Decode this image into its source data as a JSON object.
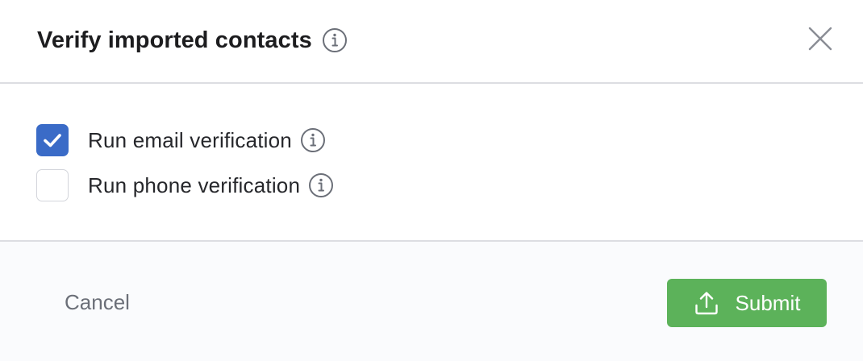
{
  "dialog": {
    "title": "Verify imported contacts",
    "close_icon": "close-icon",
    "title_info_icon": "info-icon"
  },
  "options": [
    {
      "label": "Run email verification",
      "checked": true,
      "info_icon": "info-icon"
    },
    {
      "label": "Run phone verification",
      "checked": false,
      "info_icon": "info-icon"
    }
  ],
  "footer": {
    "cancel_label": "Cancel",
    "submit_label": "Submit",
    "submit_icon": "upload-icon"
  },
  "colors": {
    "checkbox_checked": "#3a6bc7",
    "submit_button": "#5cb25a",
    "footer_background": "#fafbfd",
    "divider": "#dcdde2"
  }
}
